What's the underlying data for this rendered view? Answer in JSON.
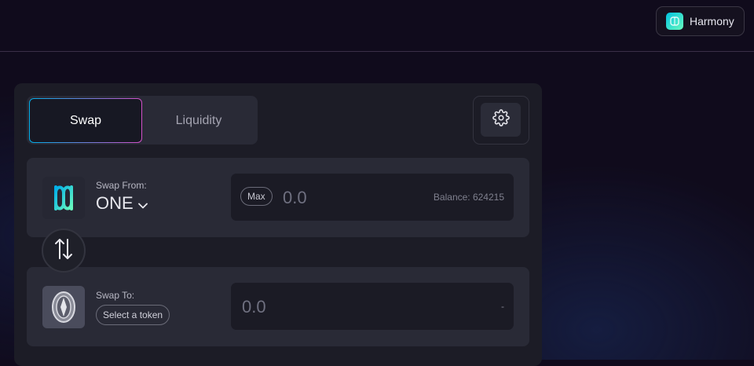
{
  "header": {
    "network": {
      "label": "Harmony",
      "icon": "harmony-network-icon"
    }
  },
  "tabs": [
    {
      "label": "Swap",
      "active": true
    },
    {
      "label": "Liquidity",
      "active": false
    }
  ],
  "settings": {
    "icon": "gear-icon"
  },
  "swap_from": {
    "label": "Swap From:",
    "token": "ONE",
    "token_icon": "harmony-one-icon",
    "max_label": "Max",
    "amount_placeholder": "0.0",
    "balance_text": "Balance: 624215"
  },
  "swap_direction": {
    "icon": "swap-arrows-icon"
  },
  "swap_to": {
    "label": "Swap To:",
    "select_token_label": "Select a token",
    "token_icon": "placeholder-token-icon",
    "amount_placeholder": "0.0",
    "balance_text": "-"
  },
  "colors": {
    "background": "#100b1c",
    "card": "#1c1c26",
    "panel": "#292a36",
    "tab_border_gradient_start": "#00aee9",
    "tab_border_gradient_end": "#d44fc9",
    "harmony_logo_start": "#00aee9",
    "harmony_logo_end": "#69fabd"
  }
}
